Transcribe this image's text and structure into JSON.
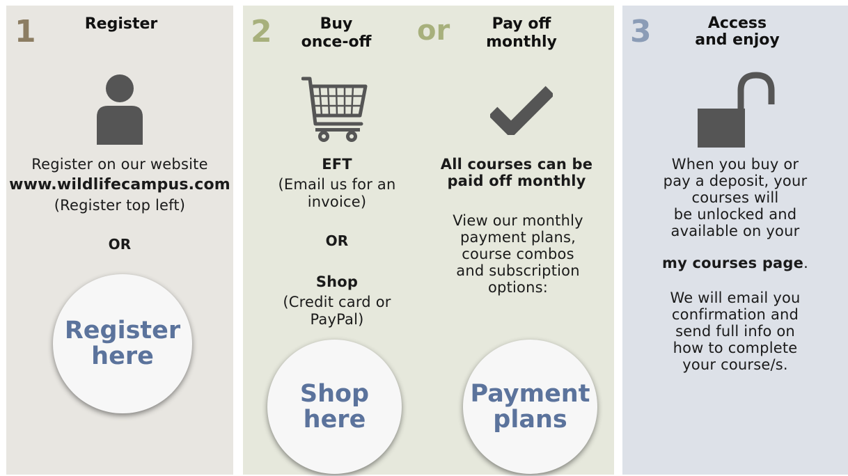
{
  "colors": {
    "panel1_bg": "#e8e6e1",
    "panel2_bg": "#e6e8dc",
    "panel3_bg": "#dde1e8",
    "step1_number": "#8c7d62",
    "step2_number": "#a7b07c",
    "step3_number": "#8b9cb6",
    "button_text": "#5b739c",
    "icon_gray": "#555555"
  },
  "step1": {
    "number": "1",
    "heading": "Register",
    "icon": "person-icon",
    "line1": "Register on our website",
    "website": "www.wildlifecampus.com",
    "line3": "(Register top left)",
    "or": "OR",
    "button": "Register\nhere"
  },
  "step2": {
    "number": "2",
    "heading_once": "Buy\nonce-off",
    "or_word": "or",
    "heading_monthly": "Pay off\nmonthly",
    "cart_icon": "shopping-cart-icon",
    "check_icon": "checkmark-icon",
    "eft_title": "EFT",
    "eft_desc": "(Email us for an\ninvoice)",
    "or": "OR",
    "shop_title": "Shop",
    "shop_desc": "(Credit card or\nPayPal)",
    "monthly_title": "All courses can be\npaid off monthly",
    "monthly_desc": "View our monthly\npayment plans,\ncourse combos\nand subscription\noptions:",
    "shop_button": "Shop\nhere",
    "plans_button": "Payment\nplans"
  },
  "step3": {
    "number": "3",
    "heading": "Access\nand enjoy",
    "icon": "unlocked-padlock-icon",
    "unlock_text": "When you buy or\npay a deposit, your\ncourses will\nbe unlocked and\navailable on your",
    "courses_page": "my courses page",
    "period": ".",
    "email_text": "We will email you\nconfirmation and\nsend full info on\nhow to complete\nyour course/s."
  }
}
